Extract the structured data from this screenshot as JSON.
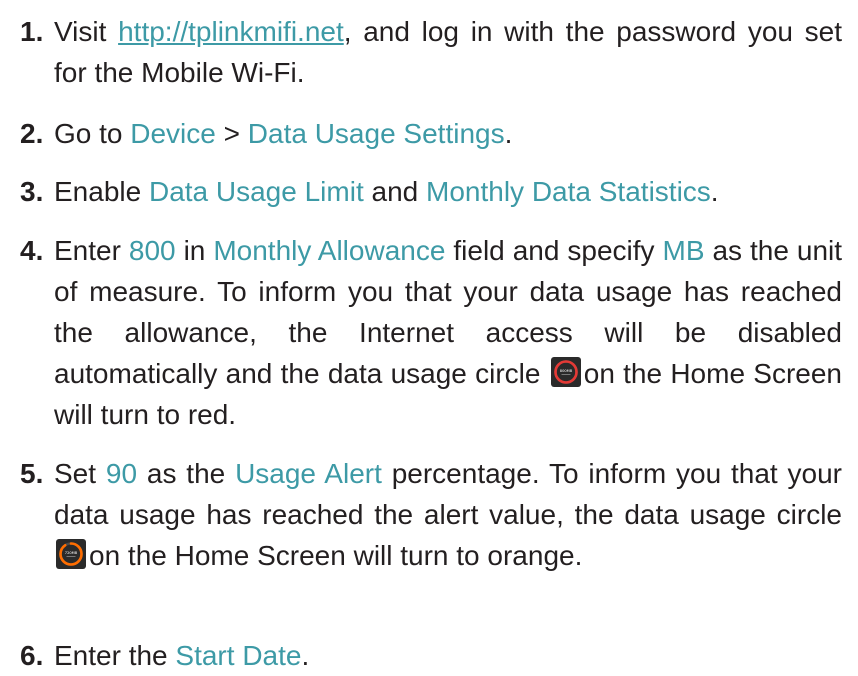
{
  "steps": [
    {
      "num": "1.",
      "t1": "Visit ",
      "link": "http://tplinkmifi.net",
      "t2": ", and log in with the password you set for the Mobile Wi-Fi."
    },
    {
      "num": "2.",
      "t1": "Go to ",
      "h1": "Device",
      "t2": " > ",
      "h2": "Data Usage Settings",
      "t3": "."
    },
    {
      "num": "3.",
      "t1": "Enable ",
      "h1": "Data Usage Limit",
      "t2": " and ",
      "h2": "Monthly Data Statistics",
      "t3": "."
    },
    {
      "num": "4.",
      "t1": "Enter ",
      "h1": "800",
      "t2": " in ",
      "h2": "Monthly Allowance",
      "t3": " field and specify ",
      "h3": "MB",
      "t4": " as the unit of measure. To inform you that your data usage has reached the allowance, the Internet access will be disabled automatically and the data usage circle",
      "t5": "on the Home Screen  will turn to red.",
      "icon": {
        "name": "data-usage-circle-red-icon",
        "ring_color": "#e53935",
        "label": "800MB",
        "fill": 1.0
      }
    },
    {
      "num": "5.",
      "t1": "Set ",
      "h1": "90",
      "t2": " as the ",
      "h2": "Usage Alert",
      "t3": " percentage. To inform you that your data usage has reached the alert value, the data usage circle",
      "t4": "on the Home Screen will turn to orange.",
      "icon": {
        "name": "data-usage-circle-orange-icon",
        "ring_color": "#ff6d00",
        "label": "720MB",
        "fill": 0.9
      }
    },
    {
      "num": "6.",
      "t1": "Enter the ",
      "h1": "Start Date",
      "t2": "."
    }
  ]
}
